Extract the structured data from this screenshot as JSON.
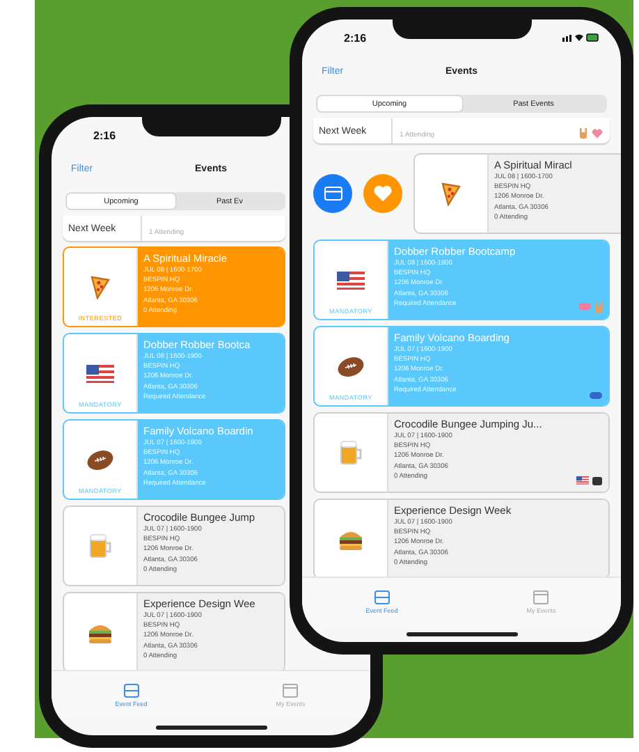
{
  "back_phone": {
    "time": "2:16",
    "filter": "Filter",
    "title": "Events",
    "segments": [
      {
        "label": "Upcoming",
        "selected": true
      },
      {
        "label": "Past Ev",
        "selected": false
      }
    ],
    "section": {
      "label": "Next Week",
      "lines": [
        "1 Attending"
      ]
    },
    "cards": [
      {
        "kind": "interested",
        "swiped": false,
        "title": "A Spiritual Miracle",
        "lines": [
          "JUL 08 | 1600-1700",
          "BESPIN HQ",
          "1206 Monroe Dr.",
          "Atlanta, GA 30306",
          "0 Attending"
        ],
        "badge": "INTERESTED"
      },
      {
        "kind": "mandatory",
        "swiped": false,
        "title": "Dobber Robber Bootca",
        "lines": [
          "JUL 08 | 1600-1900",
          "BESPIN HQ",
          "1206 Monroe Dr.",
          "Atlanta, GA 30306",
          "Required Attendance"
        ],
        "badge": "MANDATORY"
      },
      {
        "kind": "mandatory",
        "swiped": false,
        "title": "Family Volcano Boardin",
        "lines": [
          "JUL 07 | 1600-1900",
          "BESPIN HQ",
          "1206 Monroe Dr.",
          "Atlanta, GA 30306",
          "Required Attendance"
        ],
        "badge": "MANDATORY"
      },
      {
        "kind": "normal",
        "swiped": false,
        "title": "Crocodile Bungee Jump",
        "lines": [
          "JUL 07 | 1600-1900",
          "BESPIN HQ",
          "1206 Monroe Dr.",
          "Atlanta, GA 30306",
          "0 Attending"
        ]
      },
      {
        "kind": "normal",
        "swiped": false,
        "title": "Experience Design Wee",
        "lines": [
          "JUL 07 | 1600-1900",
          "BESPIN HQ",
          "1206 Monroe Dr.",
          "Atlanta, GA 30306",
          "0 Attending"
        ]
      }
    ],
    "tabs": [
      {
        "label": "Event Feed",
        "selected": true
      },
      {
        "label": "My Events",
        "selected": false
      }
    ]
  },
  "front_phone": {
    "time": "2:16",
    "filter": "Filter",
    "title": "Events",
    "segments": [
      {
        "label": "Upcoming",
        "selected": true
      },
      {
        "label": "Past Events",
        "selected": false
      }
    ],
    "section": {
      "label": "Next Week",
      "lines": [
        "1 Attending"
      ]
    },
    "cards": [
      {
        "kind": "normal",
        "swiped": true,
        "title": "A Spiritual Miracl",
        "lines": [
          "JUL 08 | 1600-1700",
          "BESPIN HQ",
          "1206 Monroe Dr.",
          "Atlanta, GA 30306",
          "0 Attending"
        ]
      },
      {
        "kind": "mandatory",
        "swiped": false,
        "title": "Dobber Robber Bootcamp",
        "lines": [
          "JUL 08 | 1600-1900",
          "BESPIN HQ",
          "1206 Monroe Dr.",
          "Atlanta, GA 30306",
          "Required Attendance"
        ],
        "badge": "MANDATORY"
      },
      {
        "kind": "mandatory",
        "swiped": false,
        "title": "Family Volcano Boarding",
        "lines": [
          "JUL 07 | 1600-1900",
          "BESPIN HQ",
          "1206 Monroe Dr.",
          "Atlanta, GA 30306",
          "Required Attendance"
        ],
        "badge": "MANDATORY"
      },
      {
        "kind": "normal",
        "swiped": false,
        "title": "Crocodile Bungee Jumping Ju...",
        "lines": [
          "JUL 07 | 1600-1900",
          "BESPIN HQ",
          "1206 Monroe Dr.",
          "Atlanta, GA 30306",
          "0 Attending"
        ]
      },
      {
        "kind": "normal",
        "swiped": false,
        "title": "Experience Design Week",
        "lines": [
          "JUL 07 | 1600-1900",
          "BESPIN HQ",
          "1206 Monroe Dr.",
          "Atlanta, GA 30306",
          "0 Attending"
        ]
      }
    ],
    "tabs": [
      {
        "label": "Event Feed",
        "selected": true
      },
      {
        "label": "My Events",
        "selected": false
      }
    ]
  }
}
